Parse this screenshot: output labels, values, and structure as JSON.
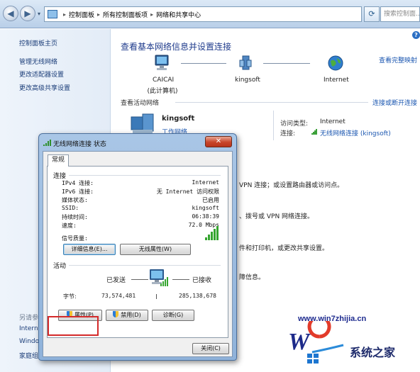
{
  "address_bar": {
    "crumbs": [
      "控制面板",
      "所有控制面板项",
      "网络和共享中心"
    ],
    "search_placeholder": "搜索控制面..."
  },
  "left_nav": {
    "items": [
      "控制面板主页",
      "管理无线网络",
      "更改适配器设置",
      "更改高级共享设置"
    ],
    "see_also_label": "另请参阅",
    "bottom_items": [
      "Interne",
      "Windo",
      "家庭组"
    ]
  },
  "main": {
    "title": "查看基本网络信息并设置连接",
    "full_map_link": "查看完整映射",
    "map": {
      "nodes": [
        {
          "name": "CAICAI",
          "sub": "(此计算机)"
        },
        {
          "name": "kingsoft",
          "sub": ""
        },
        {
          "name": "Internet",
          "sub": ""
        }
      ]
    },
    "active_networks_label": "查看活动网络",
    "connect_disconnect_link": "连接或断开连接",
    "network": {
      "name": "kingsoft",
      "type": "工作网络",
      "access_type_label": "访问类型:",
      "access_type_value": "Internet",
      "connection_label": "连接:",
      "connection_value": "无线网络连接 (kingsoft)"
    },
    "background_texts": [
      "VPN 连接；或设置路由器或访问点。",
      "、拨号或 VPN 网络连接。",
      "件和打印机，或更改共享设置。",
      "障信息。"
    ]
  },
  "dialog": {
    "title": "无线网络连接 状态",
    "close_symbol": "✕",
    "tab": "常规",
    "connection_group": "连接",
    "rows": [
      {
        "label": "IPv4 连接:",
        "value": "Internet"
      },
      {
        "label": "IPv6 连接:",
        "value": "无 Internet 访问权限"
      },
      {
        "label": "媒体状态:",
        "value": "已启用"
      },
      {
        "label": "SSID:",
        "value": "kingsoft"
      },
      {
        "label": "持续时间:",
        "value": "06:38:39"
      },
      {
        "label": "速度:",
        "value": "72.0 Mbps"
      }
    ],
    "signal_label": "信号质量:",
    "signal_level_bars": 5,
    "details_button": "详细信息(E)...",
    "wireless_props_button": "无线属性(W)",
    "activity_group": "活动",
    "sent_label": "已发送",
    "received_label": "已接收",
    "bytes_label": "字节:",
    "bytes_sent": "73,574,481",
    "bytes_received": "285,138,678",
    "properties_button": "属性(P)",
    "disable_button": "禁用(D)",
    "diagnose_button": "诊断(G)",
    "close_button": "关闭(C)"
  },
  "watermark": {
    "url": "www.win7zhijia.cn",
    "text": "系统之家"
  }
}
